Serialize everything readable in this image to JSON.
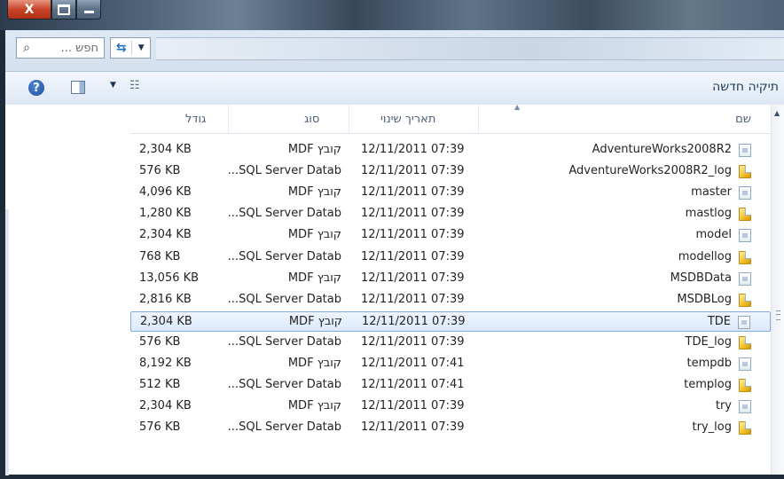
{
  "window": {
    "close_glyph": "X",
    "maximize_icon": "maximize-icon",
    "minimize_icon": "minimize-icon"
  },
  "search": {
    "placeholder": "חפש ..."
  },
  "toolbar": {
    "new_folder_label": "תיקיה חדשה"
  },
  "columns": {
    "size": "גודל",
    "type": "סוג",
    "date": "תאריך שינוי",
    "name": "שם"
  },
  "files": [
    {
      "name": "AdventureWorks2008R2",
      "date": "12/11/2011 07:39",
      "type": "קובץ MDF",
      "size": "2,304 KB",
      "icon": "mdf-file-icon"
    },
    {
      "name": "AdventureWorks2008R2_log",
      "date": "12/11/2011 07:39",
      "type": "SQL Server Datab...",
      "size": "576 KB",
      "icon": "log-file-icon"
    },
    {
      "name": "master",
      "date": "12/11/2011 07:39",
      "type": "קובץ MDF",
      "size": "4,096 KB",
      "icon": "mdf-file-icon"
    },
    {
      "name": "mastlog",
      "date": "12/11/2011 07:39",
      "type": "SQL Server Datab...",
      "size": "1,280 KB",
      "icon": "log-file-icon"
    },
    {
      "name": "model",
      "date": "12/11/2011 07:39",
      "type": "קובץ MDF",
      "size": "2,304 KB",
      "icon": "mdf-file-icon"
    },
    {
      "name": "modellog",
      "date": "12/11/2011 07:39",
      "type": "SQL Server Datab...",
      "size": "768 KB",
      "icon": "log-file-icon"
    },
    {
      "name": "MSDBData",
      "date": "12/11/2011 07:39",
      "type": "קובץ MDF",
      "size": "13,056 KB",
      "icon": "mdf-file-icon"
    },
    {
      "name": "MSDBLog",
      "date": "12/11/2011 07:39",
      "type": "SQL Server Datab...",
      "size": "2,816 KB",
      "icon": "log-file-icon"
    },
    {
      "name": "TDE",
      "date": "12/11/2011 07:39",
      "type": "קובץ MDF",
      "size": "2,304 KB",
      "icon": "mdf-file-icon",
      "selected": true
    },
    {
      "name": "TDE_log",
      "date": "12/11/2011 07:39",
      "type": "SQL Server Datab...",
      "size": "576 KB",
      "icon": "log-file-icon"
    },
    {
      "name": "tempdb",
      "date": "12/11/2011 07:41",
      "type": "קובץ MDF",
      "size": "8,192 KB",
      "icon": "mdf-file-icon"
    },
    {
      "name": "templog",
      "date": "12/11/2011 07:41",
      "type": "SQL Server Datab...",
      "size": "512 KB",
      "icon": "log-file-icon"
    },
    {
      "name": "try",
      "date": "12/11/2011 07:39",
      "type": "קובץ MDF",
      "size": "2,304 KB",
      "icon": "mdf-file-icon"
    },
    {
      "name": "try_log",
      "date": "12/11/2011 07:39",
      "type": "SQL Server Datab...",
      "size": "576 KB",
      "icon": "log-file-icon"
    }
  ]
}
